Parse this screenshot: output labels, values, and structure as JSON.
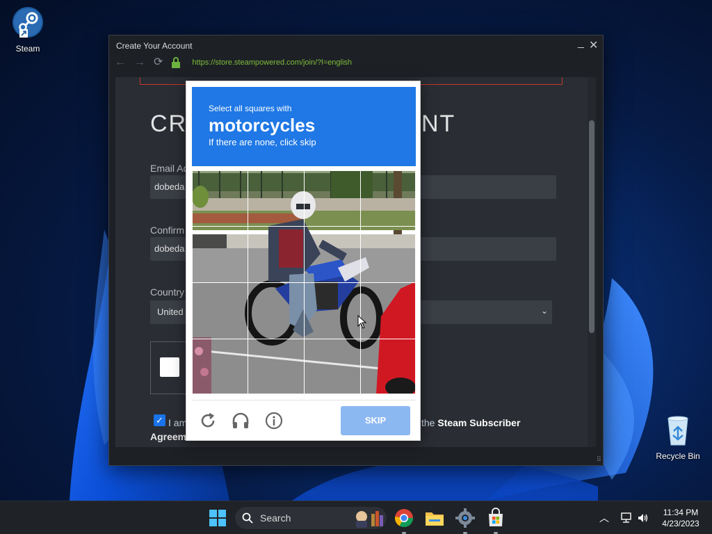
{
  "desktop": {
    "steam_icon_label": "Steam",
    "recycle_bin_label": "Recycle Bin"
  },
  "window": {
    "title": "Create Your Account",
    "url": "https://store.steampowered.com/join/?l=english",
    "heading_left": "CRE",
    "heading_right": "NT",
    "email_label": "Email Ad",
    "email_value": "dobeda",
    "confirm_label": "Confirm",
    "confirm_value": "dobeda",
    "country_label": "Country",
    "country_value": "United",
    "agree_text_start": "I am",
    "agree_text_mid": "the",
    "agree_link": "Steam Subscriber",
    "agree_text_end": "Agreem"
  },
  "captcha": {
    "prompt_line": "Select all squares with",
    "target": "motorcycles",
    "hint": "If there are none, click skip",
    "skip_label": "SKIP",
    "refresh_icon": "refresh-icon",
    "audio_icon": "headphones-icon",
    "info_icon": "info-icon"
  },
  "taskbar": {
    "search_label": "Search",
    "time": "11:34 PM",
    "date": "4/23/2023"
  },
  "colors": {
    "captcha_blue": "#1f78e5",
    "skip_disabled": "#8cb8f2",
    "url_green": "#7fbd3b"
  }
}
